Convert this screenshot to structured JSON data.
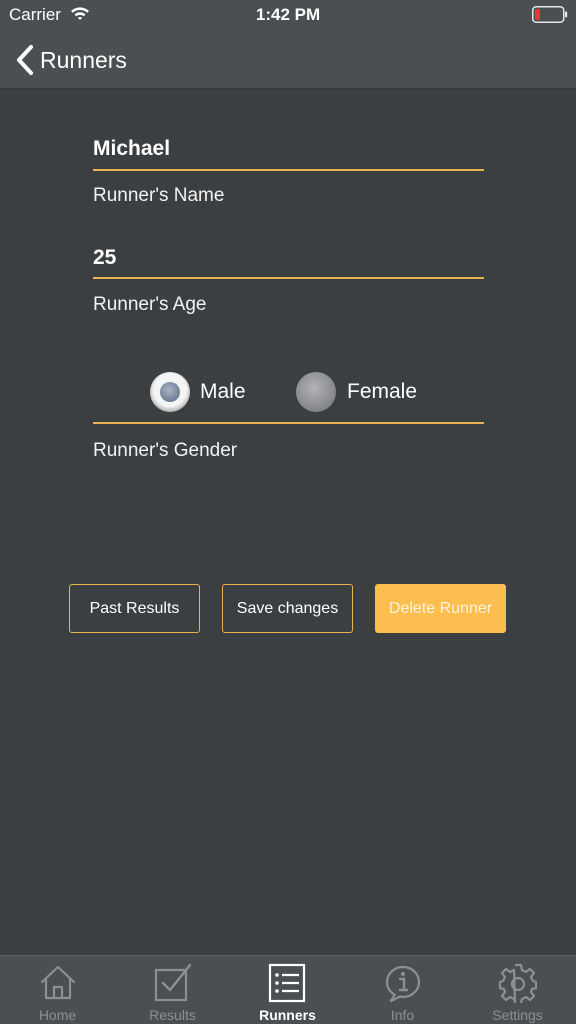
{
  "status_bar": {
    "carrier": "Carrier",
    "time": "1:42 PM"
  },
  "nav": {
    "back_label": "Runners"
  },
  "form": {
    "name_value": "Michael",
    "name_label": "Runner's Name",
    "age_value": "25",
    "age_label": "Runner's Age",
    "gender_options": [
      {
        "label": "Male",
        "selected": true
      },
      {
        "label": "Female",
        "selected": false
      }
    ],
    "gender_label": "Runner's Gender"
  },
  "actions": {
    "past_results": "Past Results",
    "save_changes": "Save changes",
    "delete_runner": "Delete Runner"
  },
  "tabs": [
    {
      "label": "Home",
      "icon": "home-icon",
      "active": false
    },
    {
      "label": "Results",
      "icon": "checkbox-icon",
      "active": false
    },
    {
      "label": "Runners",
      "icon": "list-icon",
      "active": true
    },
    {
      "label": "Info",
      "icon": "info-icon",
      "active": false
    },
    {
      "label": "Settings",
      "icon": "gear-icon",
      "active": false
    }
  ],
  "colors": {
    "accent": "#e9b34f",
    "delete_fill": "#fdbe50",
    "background": "#3b3f42",
    "bar": "#4a4f51"
  }
}
